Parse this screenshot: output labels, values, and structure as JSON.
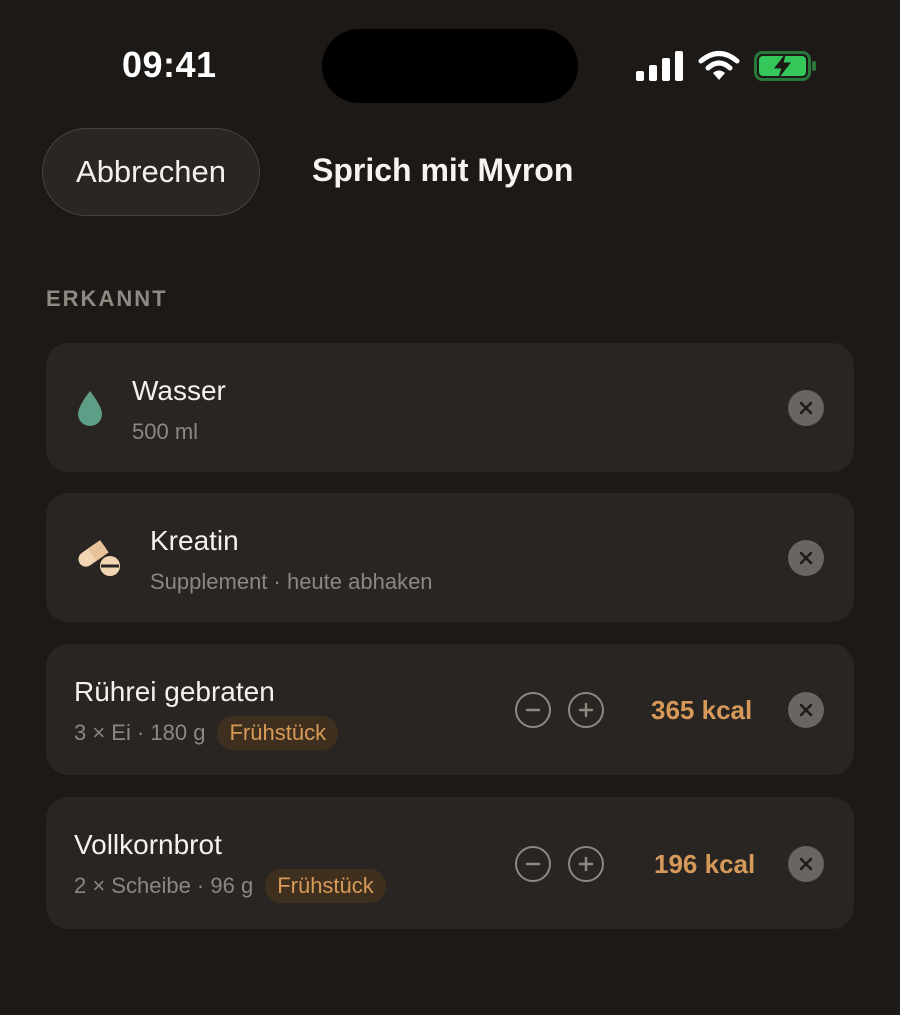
{
  "status_bar": {
    "time": "09:41",
    "icons": [
      "signal-icon",
      "wifi-icon",
      "battery-charging-icon"
    ],
    "battery_color": "#34c759"
  },
  "header": {
    "cancel_label": "Abbrechen",
    "title": "Sprich mit Myron"
  },
  "section": {
    "label": "ERKANNT"
  },
  "items": [
    {
      "icon": "water-drop-icon",
      "name": "Wasser",
      "detail": "500 ml"
    },
    {
      "icon": "pill-icon",
      "name": "Kreatin",
      "detail": "Supplement · heute abhaken"
    },
    {
      "name": "Rührei gebraten",
      "detail": "3 × Ei · 180 g",
      "meal": "Frühstück",
      "kcal": "365 kcal"
    },
    {
      "name": "Vollkornbrot",
      "detail": "2 × Scheibe · 96 g",
      "meal": "Frühstück",
      "kcal": "196 kcal"
    }
  ],
  "colors": {
    "background": "#1c1917",
    "card": "#282522",
    "accent": "#d7995a",
    "water": "#5f9e86"
  }
}
